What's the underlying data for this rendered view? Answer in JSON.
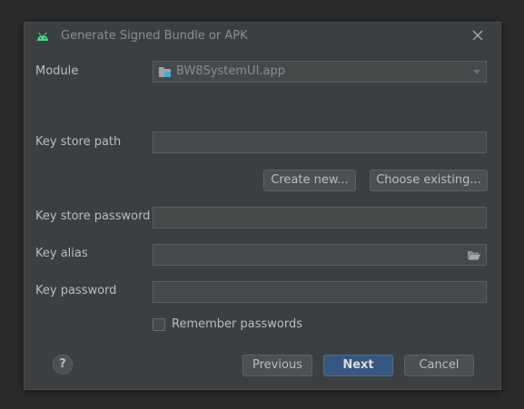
{
  "window": {
    "title": "Generate Signed Bundle or APK",
    "icon": "android-icon",
    "close_icon": "close-icon"
  },
  "module": {
    "label": "Module",
    "selected": "BW8SystemUI.app"
  },
  "key_store_path": {
    "label": "Key store path",
    "value": ""
  },
  "key_store_buttons": {
    "create_new": "Create new...",
    "choose_existing": "Choose existing..."
  },
  "key_store_password": {
    "label": "Key store password",
    "value": ""
  },
  "key_alias": {
    "label": "Key alias",
    "value": "",
    "browse_icon": "folder-icon"
  },
  "key_password": {
    "label": "Key password",
    "value": ""
  },
  "remember": {
    "label": "Remember passwords",
    "checked": false
  },
  "footer": {
    "help": "?",
    "previous": "Previous",
    "next": "Next",
    "cancel": "Cancel"
  },
  "colors": {
    "background": "#3c3f41",
    "primary_button": "#365880",
    "android_green": "#3ddc84"
  }
}
